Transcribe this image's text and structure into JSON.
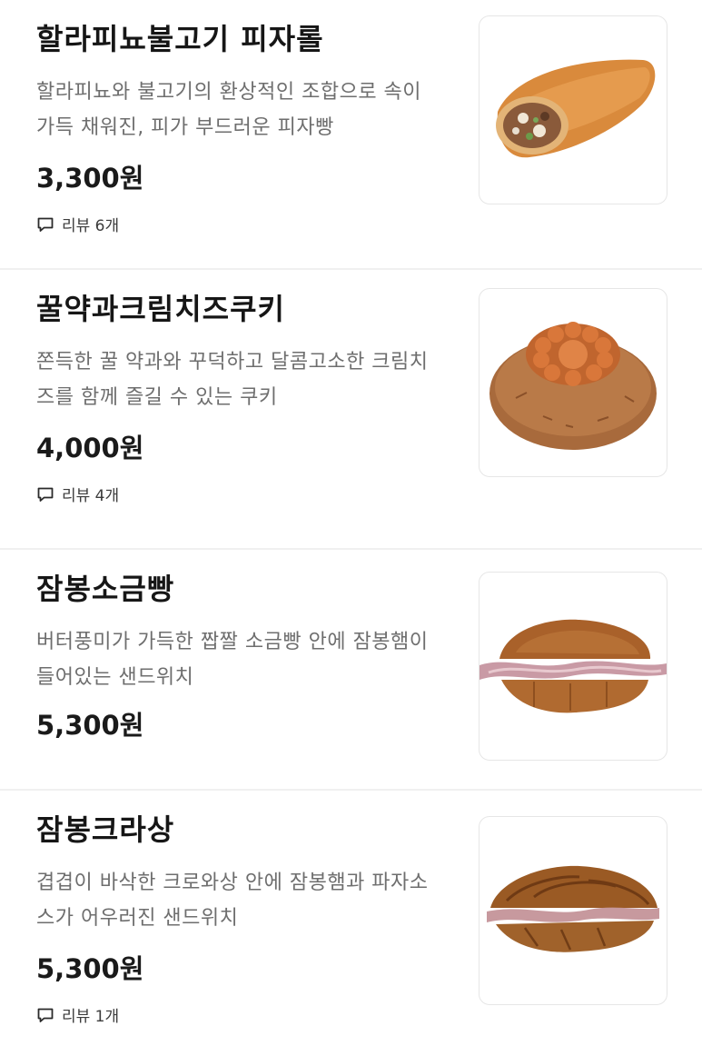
{
  "items": [
    {
      "title": "할라피뇨불고기 피자롤",
      "description": "할라피뇨와 불고기의 환상적인 조합으로 속이 가득 채워진, 피가 부드러운 피자빵",
      "price": "3,300원",
      "review": "리뷰 6개",
      "image_icon": "pizza-roll-image"
    },
    {
      "title": "꿀약과크림치즈쿠키",
      "description": "쫀득한 꿀 약과와 꾸덕하고 달콤고소한 크림치즈를 함께 즐길 수 있는 쿠키",
      "price": "4,000원",
      "review": "리뷰 4개",
      "image_icon": "yakgwa-cookie-image"
    },
    {
      "title": "잠봉소금빵",
      "description": "버터풍미가 가득한 짭짤 소금빵 안에 잠봉햄이 들어있는 샌드위치",
      "price": "5,300원",
      "image_icon": "jambon-salt-bread-image"
    },
    {
      "title": "잠봉크라상",
      "description": "겹겹이 바삭한 크로와상 안에 잠봉햄과 파자소스가 어우러진 샌드위치",
      "price": "5,300원",
      "review": "리뷰 1개",
      "image_icon": "jambon-croissant-image"
    }
  ],
  "colors": {
    "title": "#161616",
    "description": "#6e6e6e",
    "divider": "#f0f0f0",
    "thumb_border": "#e6e6e6"
  }
}
